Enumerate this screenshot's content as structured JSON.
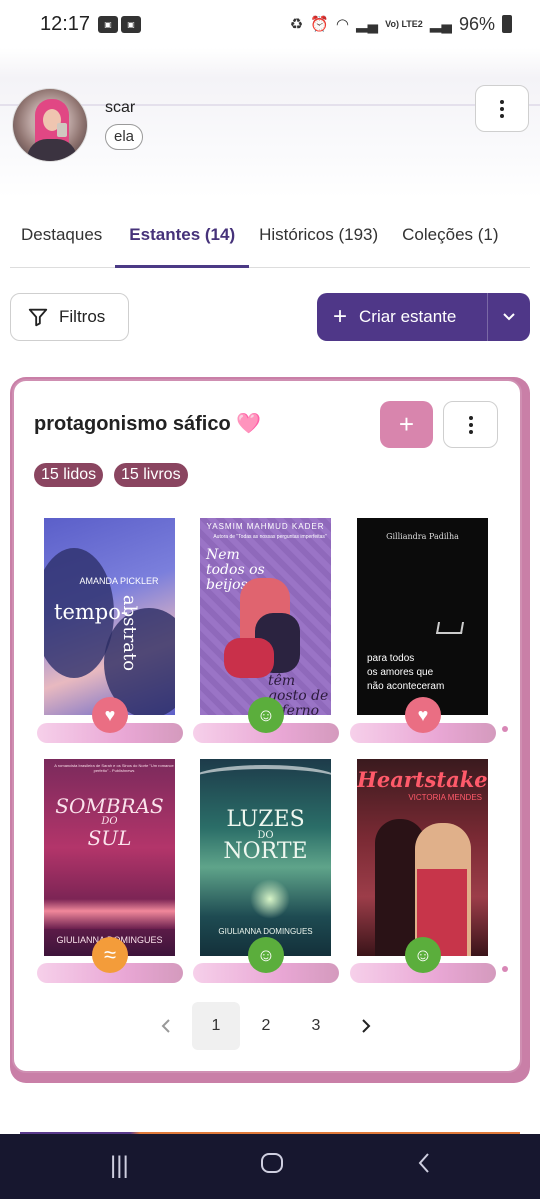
{
  "status_bar": {
    "time": "12:17",
    "lte_label": "Vo) LTE2",
    "battery": "96%"
  },
  "profile": {
    "name": "scar",
    "pronoun": "ela"
  },
  "tabs": [
    {
      "label": "Destaques"
    },
    {
      "label": "Estantes (14)"
    },
    {
      "label": "Históricos (193)"
    },
    {
      "label": "Coleções (1)"
    }
  ],
  "toolbar": {
    "filter_label": "Filtros",
    "create_label": "Criar estante"
  },
  "shelf": {
    "title": "protagonismo sáfico",
    "emoji": "🩷",
    "read_badge": "15 lidos",
    "books_badge": "15 livros",
    "books": [
      {
        "title_parts": [
          "tempo-",
          "abstrato"
        ],
        "author": "AMANDA PICKLER",
        "status": "heart"
      },
      {
        "title_parts": [
          "Nem todos os beijos",
          "têm gosto de inferno"
        ],
        "author": "YASMIM MAHMUD KADER",
        "tagline": "Autora de \"Todas as nossas perguntas imperfeitas\"",
        "status": "smile"
      },
      {
        "title_parts": [
          "para todos",
          "os amores que",
          "não aconteceram"
        ],
        "author": "Gilliandra Padilha",
        "status": "heart"
      },
      {
        "title_parts": [
          "SOMBRAS",
          "DO",
          "SUL"
        ],
        "author": "GIULIANNA DOMINGUES",
        "tagline": "A romancista brasileira de Sarah e os Sinos do Norte \"Um romance perfeito\" - Publishnews",
        "status": "wave"
      },
      {
        "title_parts": [
          "LUZES",
          "DO",
          "NORTE"
        ],
        "author": "GIULIANNA DOMINGUES",
        "status": "smile"
      },
      {
        "title_parts": [
          "Heartstaker"
        ],
        "author": "VICTORIA MENDES",
        "status": "smile"
      }
    ]
  },
  "pagination": {
    "pages": [
      "1",
      "2",
      "3"
    ],
    "current": "1"
  }
}
